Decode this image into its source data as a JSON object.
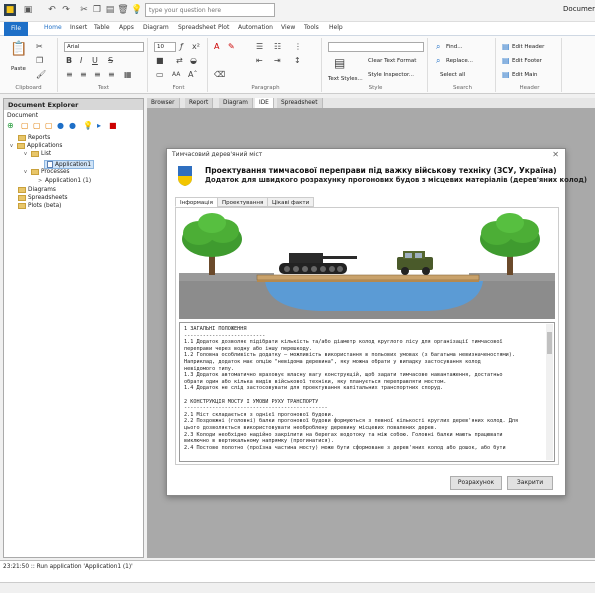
{
  "qat": {
    "search_placeholder": "type your question here",
    "window_title": "Documer"
  },
  "menu": {
    "file": "File",
    "tabs": [
      "Home",
      "Insert",
      "Table",
      "Apps",
      "Diagram",
      "Spreadsheet",
      "Plot",
      "Automation",
      "View",
      "Tools",
      "Help"
    ]
  },
  "ribbon": {
    "paste": "Paste",
    "font_name": "Arial",
    "font_size": "10",
    "clear_text_format": "Clear Text Format",
    "text_styles": "Text Styles...",
    "style_inspector": "Style Inspector...",
    "find": "Find...",
    "replace": "Replace...",
    "select_all": "Select all",
    "edit_header": "Edit Header",
    "edit_footer": "Edit Footer",
    "edit_main": "Edit Main",
    "groups": {
      "clipboard": "Clipboard",
      "text": "Text",
      "font": "Font",
      "paragraph": "Paragraph",
      "style": "Style",
      "search": "Search",
      "header": "Header"
    }
  },
  "explorer": {
    "title": "Document Explorer",
    "doc_label": "Document",
    "tree": {
      "reports": "Reports",
      "applications": "Applications",
      "list": "List",
      "app1": "Application1",
      "processes": "Processes",
      "app1_proc": "Application1 (1)",
      "diagrams": "Diagrams",
      "spreadsheets": "Spreadsheets",
      "plots": "Plots (beta)"
    }
  },
  "doctabs": [
    "Browser",
    "Report",
    "Diagram",
    "IDE",
    "Spreadsheet"
  ],
  "dialog": {
    "title": "Тимчасовий дерев'яний міст",
    "header_title": "Проектування тимчасової переправи під важку військову техніку (ЗСУ, Україна)",
    "header_subtitle": "Додаток для швидкого розрахунку прогонових будов з місцевих матеріалів (дерев'яних колод)",
    "tabs": [
      "Інформація",
      "Проектування",
      "Цікаві факти"
    ],
    "text_lines": [
      "1 ЗАГАЛЬНІ ПОЛОЖЕННЯ",
      "--------------------------",
      "1.1 Додаток дозволяє підібрати кількість та/або діаметр колод круглого лісу для організації тимчасової",
      "переправи через водну або іншу перешкоду.",
      "1.2 Головна особливість додатку — можливість використання в польових умовах (з багатьма невизначеностями).",
      "Наприклад, додаток має опцію \"невідома деревина\", яку можна обрати у випадку застосування колод",
      "невідомого типу.",
      "1.3 Додаток автоматично враховує власну вагу конструкцій, щоб задати тимчасове навантаження, достатньо",
      "обрати один або кілька видів військової техніки, яку планується переправляти мостом.",
      "1.4 Додаток не слід застосовувати для проектування капітальних транспортних споруд.",
      "",
      "2 КОНСТРУКЦІЯ МОСТУ І УМОВИ РУХУ ТРАНСПОРТУ",
      "----------------------------------------------",
      "2.1 Міст складається з однієї прогонової будови.",
      "2.2 Поздовжні (головні) балки прогонової будови формуються з певної кількості круглих дерев'яних колод. Для",
      "цього дозволяється використовувати необроблену деревину місцевих повалених дерев.",
      "2.3 Колоди необхідно надійно закріпити на берегах водотоку та між собою. Головні балки мають працювати",
      "виключно в вертикальному напрямку (прогинатися).",
      "2.4 Постове полотно (проїзна частина мосту) може бути сформоване з дерев'яних колод або дошок, або бути"
    ],
    "btn_calc": "Розрахунок",
    "btn_close": "Закрити"
  },
  "log": {
    "line": "23:21:50 :: Run application 'Application1 (1)'"
  },
  "colors": {
    "file_tab": "#1e6fc7",
    "shield_blue": "#2f6fc0",
    "shield_yellow": "#f2c500",
    "water": "#5b9bd5",
    "ground": "#8c8c8c"
  }
}
